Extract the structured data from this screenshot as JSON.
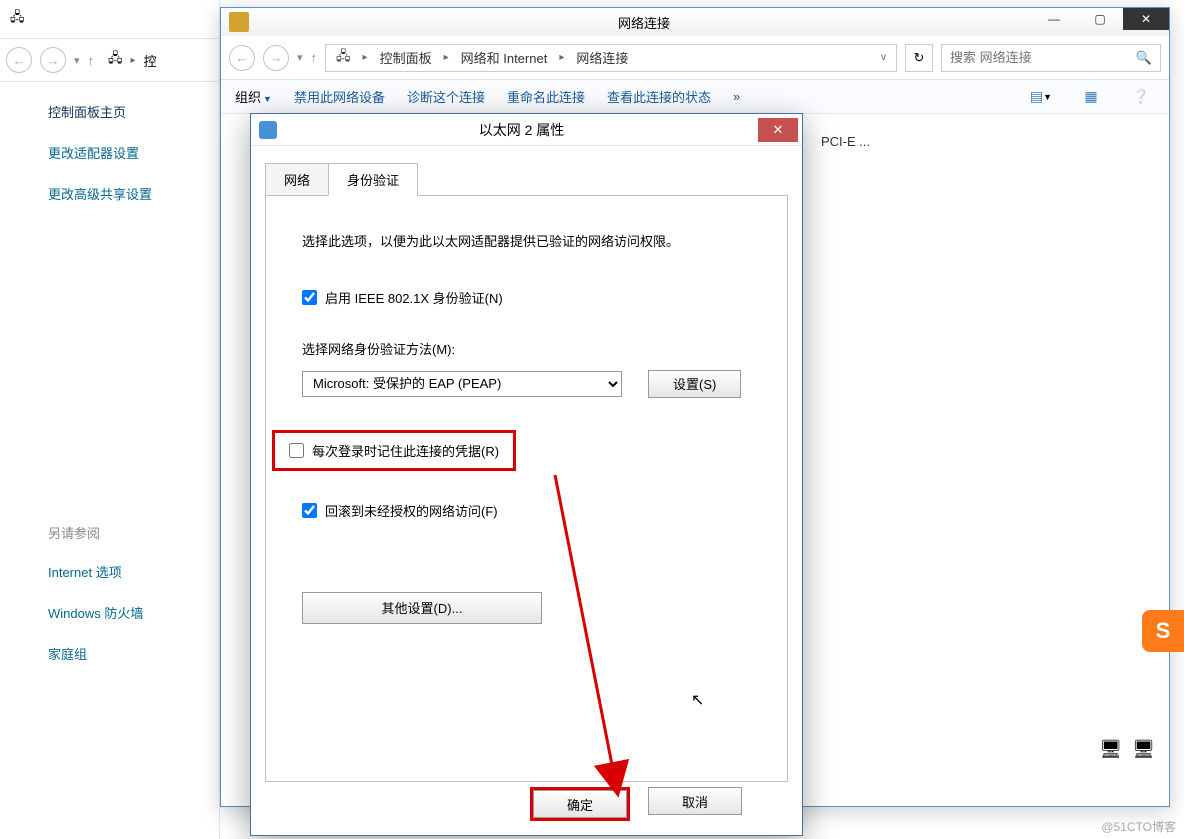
{
  "bg": {
    "sidebar": {
      "title": "控制面板主页",
      "link1": "更改适配器设置",
      "link2": "更改高级共享设置",
      "seealso_hdr": "另请参阅",
      "seealso1": "Internet 选项",
      "seealso2": "Windows 防火墙",
      "seealso3": "家庭组"
    },
    "crop_text": "控"
  },
  "main": {
    "title": "网络连接",
    "breadcrumb": {
      "b1": "控制面板",
      "b2": "网络和 Internet",
      "b3": "网络连接"
    },
    "search_placeholder": "搜索 网络连接",
    "cmdbar": {
      "org": "组织",
      "disable": "禁用此网络设备",
      "diag": "诊断这个连接",
      "rename": "重命名此连接",
      "status": "查看此连接的状态",
      "more": "»"
    },
    "body_snip": "PCI-E ..."
  },
  "dlg": {
    "title": "以太网 2 属性",
    "tabs": {
      "t1": "网络",
      "t2": "身份验证"
    },
    "desc": "选择此选项，以便为此以太网适配器提供已验证的网络访问权限。",
    "chk_8021x": "启用 IEEE 802.1X 身份验证(N)",
    "method_label": "选择网络身份验证方法(M):",
    "method_value": "Microsoft: 受保护的 EAP (PEAP)",
    "settings_btn": "设置(S)",
    "chk_remember": "每次登录时记住此连接的凭据(R)",
    "chk_fallback": "回滚到未经授权的网络访问(F)",
    "other_btn": "其他设置(D)...",
    "ok": "确定",
    "cancel": "取消"
  },
  "watermark": "@51CTO博客",
  "badge": "S"
}
